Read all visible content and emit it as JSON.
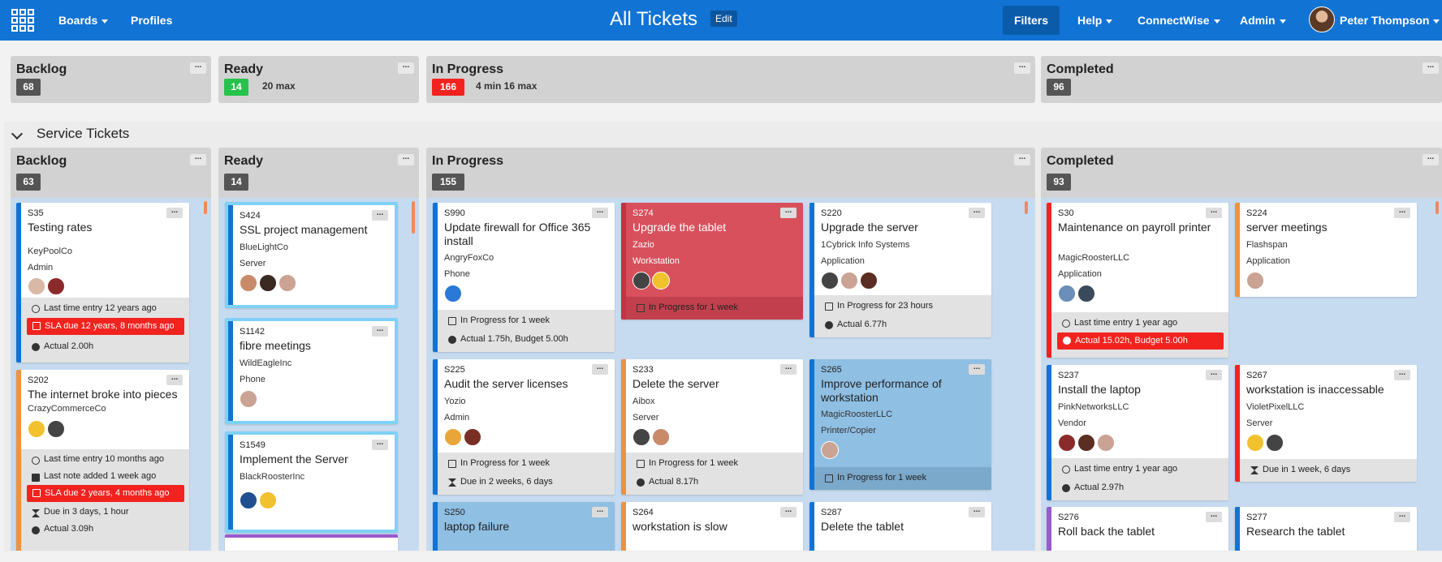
{
  "topbar": {
    "boards": "Boards",
    "profiles": "Profiles",
    "title": "All Tickets",
    "edit": "Edit",
    "filters": "Filters",
    "help": "Help",
    "connectwise": "ConnectWise",
    "admin": "Admin",
    "user": "Peter Thompson"
  },
  "colors": {
    "topbar": "#1173d4",
    "green": "#27c24c",
    "red": "#f2231f",
    "grey": "#555555",
    "lane": "#c7dbf0"
  },
  "summary": [
    {
      "name": "Backlog",
      "count": "68",
      "max": ""
    },
    {
      "name": "Ready",
      "count": "14",
      "max": "20 max"
    },
    {
      "name": "In Progress",
      "count": "166",
      "max": "4 min 16 max"
    },
    {
      "name": "Completed",
      "count": "96",
      "max": ""
    }
  ],
  "swimlane": {
    "title": "Service Tickets",
    "columns": [
      {
        "name": "Backlog",
        "count": "63"
      },
      {
        "name": "Ready",
        "count": "14"
      },
      {
        "name": "In Progress",
        "count": "155"
      },
      {
        "name": "Completed",
        "count": "93"
      }
    ]
  },
  "cards": {
    "s35": {
      "id": "S35",
      "title": "Testing rates",
      "company": "KeyPoolCo",
      "type": "Admin",
      "f1": "Last time entry 12 years ago",
      "f2": "SLA due 12 years, 8 months ago",
      "f3": "Actual 2.00h"
    },
    "s202": {
      "id": "S202",
      "title": "The internet broke into pieces",
      "company": "CrazyCommerceCo",
      "f1": "Last time entry 10 months ago",
      "f2": "Last note added 1 week ago",
      "f3": "SLA due 2 years, 4 months ago",
      "f4": "Due in 3 days, 1 hour",
      "f5": "Actual 3.09h"
    },
    "s424": {
      "id": "S424",
      "title": "SSL project management",
      "company": "BlueLightCo",
      "type": "Server"
    },
    "s1142": {
      "id": "S1142",
      "title": "fibre meetings",
      "company": "WildEagleInc",
      "type": "Phone"
    },
    "s1549": {
      "id": "S1549",
      "title": "Implement the Server",
      "company": "BlackRoosterInc"
    },
    "s990": {
      "id": "S990",
      "title": "Update firewall for Office 365 install",
      "company": "AngryFoxCo",
      "type": "Phone",
      "f1": "In Progress for 1 week",
      "f2": "Actual 1.75h, Budget 5.00h"
    },
    "s225": {
      "id": "S225",
      "title": "Audit the server licenses",
      "company": "Yozio",
      "type": "Admin",
      "f1": "In Progress for 1 week",
      "f2": "Due in 2 weeks, 6 days"
    },
    "s250": {
      "id": "S250",
      "title": "laptop failure"
    },
    "s274": {
      "id": "S274",
      "title": "Upgrade the tablet",
      "company": "Zazio",
      "type": "Workstation",
      "f1": "In Progress for 1 week"
    },
    "s233": {
      "id": "S233",
      "title": "Delete the server",
      "company": "Aibox",
      "type": "Server",
      "f1": "In Progress for 1 week",
      "f2": "Actual 8.17h"
    },
    "s264": {
      "id": "S264",
      "title": "workstation is slow"
    },
    "s220": {
      "id": "S220",
      "title": "Upgrade the server",
      "company": "1Cybrick Info Systems",
      "type": "Application",
      "f1": "In Progress for 23 hours",
      "f2": "Actual 6.77h"
    },
    "s265": {
      "id": "S265",
      "title": "Improve performance of workstation",
      "company": "MagicRoosterLLC",
      "type": "Printer/Copier",
      "f1": "In Progress for 1 week"
    },
    "s287": {
      "id": "S287",
      "title": "Delete the tablet"
    },
    "s30": {
      "id": "S30",
      "title": "Maintenance on payroll printer",
      "company": "MagicRoosterLLC",
      "type": "Application",
      "f1": "Last time entry 1 year ago",
      "f2": "Actual 15.02h, Budget 5.00h"
    },
    "s237": {
      "id": "S237",
      "title": "Install the laptop",
      "company": "PinkNetworksLLC",
      "type": "Vendor",
      "f1": "Last time entry 1 year ago",
      "f2": "Actual 2.97h"
    },
    "s276": {
      "id": "S276",
      "title": "Roll back the tablet"
    },
    "s224": {
      "id": "S224",
      "title": "server meetings",
      "company": "Flashspan",
      "type": "Application"
    },
    "s267": {
      "id": "S267",
      "title": "workstation is inaccessable",
      "company": "VioletPixelLLC",
      "type": "Server",
      "f1": "Due in 1 week, 6 days"
    },
    "s277": {
      "id": "S277",
      "title": "Research the tablet"
    }
  },
  "icons": [
    "apps-grid-icon",
    "caret-down-icon",
    "more-dots-icon",
    "clock-icon",
    "calendar-icon",
    "timer-icon",
    "board-icon",
    "hourglass-icon",
    "note-icon",
    "chevron-down-icon"
  ]
}
